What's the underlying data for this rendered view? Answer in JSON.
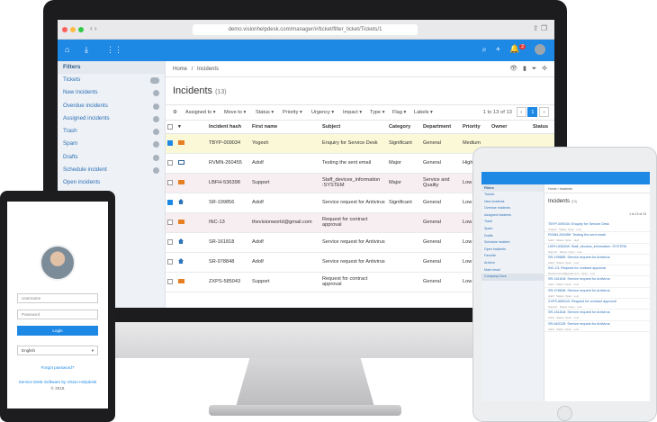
{
  "browser": {
    "url": "demo.visionhelpdesk.com/manager/#/ticket/filter_ticket/Tickets/1"
  },
  "header": {
    "notification_count": "2"
  },
  "sidebar": {
    "title": "Filters",
    "items": [
      {
        "label": "Tickets"
      },
      {
        "label": "New incidents"
      },
      {
        "label": "Overdue incidents"
      },
      {
        "label": "Assigned incidents"
      },
      {
        "label": "Trash"
      },
      {
        "label": "Spam"
      },
      {
        "label": "Drafts"
      },
      {
        "label": "Schedule incident"
      },
      {
        "label": "Open incidents"
      }
    ]
  },
  "breadcrumb": {
    "home": "Home",
    "sep": "/",
    "current": "Incidents"
  },
  "page": {
    "title": "Incidents",
    "count": "(13)"
  },
  "toolbar": {
    "items": [
      "Assigned to",
      "Move to",
      "Status",
      "Priority",
      "Urgency",
      "Impact",
      "Type",
      "Flag",
      "Labels"
    ],
    "pager_text": "1 to 13 of 13",
    "page": "1"
  },
  "table": {
    "columns": [
      "Incident hash",
      "First name",
      "Subject",
      "Category",
      "Department",
      "Priority",
      "Owner",
      "Status"
    ],
    "rows": [
      {
        "hash": "TBYP-009034",
        "first_name": "Yogesh",
        "subject": "Enquiry for Service Desk",
        "category": "Significant",
        "department": "General",
        "priority": "Medium"
      },
      {
        "hash": "RVMN-260455",
        "first_name": "Adolf",
        "subject": "Testing the sent email",
        "category": "Major",
        "department": "General",
        "priority": "High"
      },
      {
        "hash": "LBFH-536398",
        "first_name": "Support",
        "subject": "Staff_devices_information :SYSTEM",
        "category": "Major",
        "department": "Service and Quality",
        "priority": "Low"
      },
      {
        "hash": "SR-199856",
        "first_name": "Adolf",
        "subject": "Service request for Antivirus",
        "category": "Significant",
        "department": "General",
        "priority": "Low"
      },
      {
        "hash": "INC-13",
        "first_name": "thevisionworld@gmail.com",
        "subject": "Request for contract approval",
        "category": "",
        "department": "General",
        "priority": "Low"
      },
      {
        "hash": "SR-161818",
        "first_name": "Adolf",
        "subject": "Service request for Antivirus",
        "category": "",
        "department": "General",
        "priority": "Low"
      },
      {
        "hash": "SR-978848",
        "first_name": "Adolf",
        "subject": "Service request for Antivirus",
        "category": "",
        "department": "General",
        "priority": "Low"
      },
      {
        "hash": "ZXPS-585043",
        "first_name": "Support",
        "subject": "Request for contract approval",
        "category": "",
        "department": "General",
        "priority": "Low"
      }
    ]
  },
  "phone": {
    "username_placeholder": "Username",
    "password_placeholder": "Password",
    "login_label": "Login",
    "language": "English",
    "forgot": "Forgot password?",
    "footer1": "Service Desk Software by Vision Helpdesk",
    "footer2": "© 2018"
  },
  "tablet": {
    "sidebar_title": "Filters",
    "sidebar_items": [
      "Tickets",
      "New incidents",
      "Overdue incidents",
      "Assigned incidents",
      "Trash",
      "Spam",
      "Drafts",
      "Schedule incident",
      "Open incidents",
      "Favorite",
      "Archive",
      "Mark email",
      "Company Docs"
    ],
    "breadcrumb": "Home / Incidents",
    "title": "Incidents",
    "count": "(13)",
    "pager": "1 to 13 of 13",
    "list": [
      {
        "title": "TBYP-009034: Enquiry for Service Desk",
        "sub": "Yogesh · Status: Open · Low"
      },
      {
        "title": "RVMN-260455: Testing the sent email",
        "sub": "Adolf · Status: Open · High"
      },
      {
        "title": "LBFH-536398: Staff_devices_information :SYSTEM",
        "sub": "Support · Status: Open · Low"
      },
      {
        "title": "SR-199856: Service request for Antivirus",
        "sub": "Adolf · Status: Open · Low"
      },
      {
        "title": "INC-13: Request for contract approval",
        "sub": "thevisionworld@gmail.com · Open · Low"
      },
      {
        "title": "SR-161818: Service request for Antivirus",
        "sub": "Adolf · Status: Open · Low"
      },
      {
        "title": "SR-978848: Service request for Antivirus",
        "sub": "Adolf · Status: Open · Low"
      },
      {
        "title": "ZXPS-585043: Request for contract approval",
        "sub": "Support · Status: Open · Low"
      },
      {
        "title": "SR-161818: Service request for Antivirus",
        "sub": "Adolf · Status: Open · Low"
      },
      {
        "title": "SR-663135: Service request for Antivirus",
        "sub": "Adolf · Status: Open · Low"
      }
    ]
  }
}
